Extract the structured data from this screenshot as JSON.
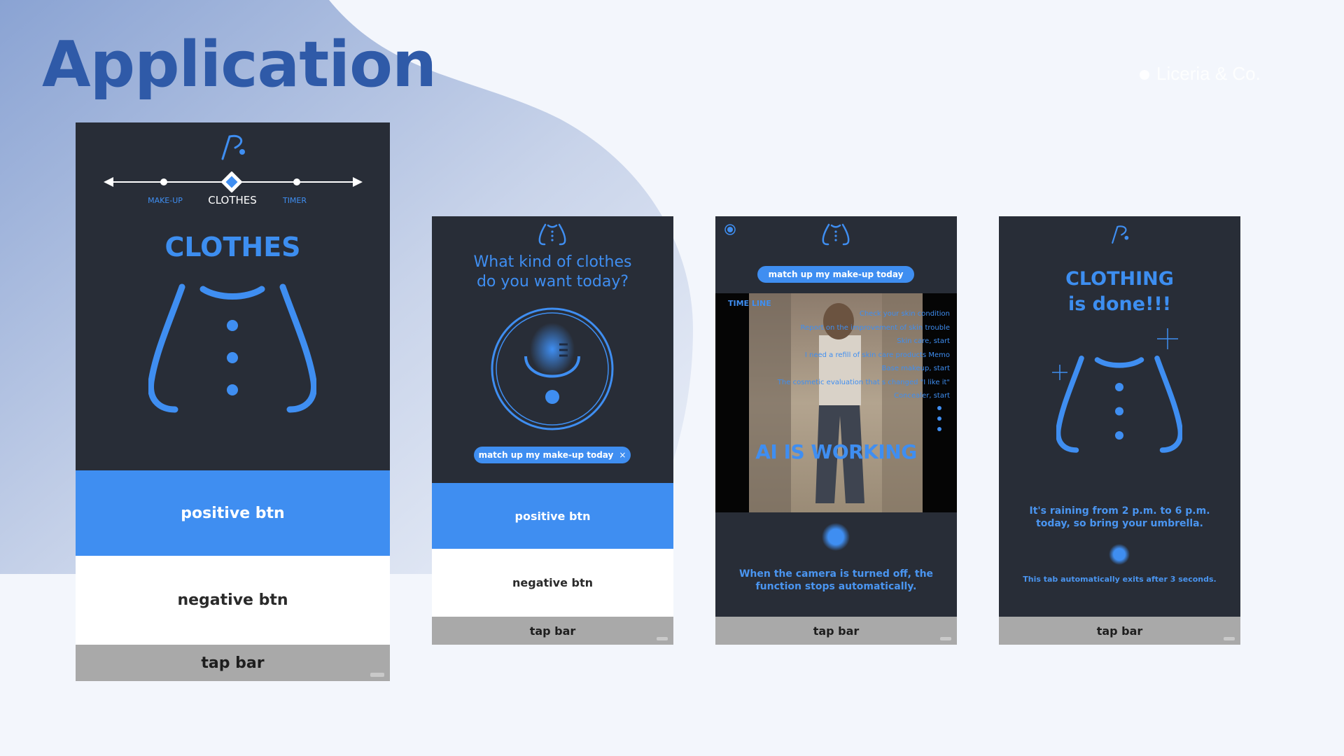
{
  "page": {
    "title": "Application",
    "brand": "Liceria & Co."
  },
  "screen1": {
    "nav": {
      "left_label": "MAKE-UP",
      "center_label": "CLOTHES",
      "right_label": "TIMER"
    },
    "heading": "CLOTHES",
    "positive_btn": "positive btn",
    "negative_btn": "negative btn",
    "tap_bar": "tap bar"
  },
  "screen2": {
    "question_line1": "What kind of clothes",
    "question_line2": "do you want today?",
    "chip": "match up my make-up today",
    "chip_close": "×",
    "positive_btn": "positive btn",
    "negative_btn": "negative btn",
    "tap_bar": "tap bar"
  },
  "screen3": {
    "pill": "match up my make-up today",
    "timeline_title": "TIME LINE",
    "timeline_items": [
      "Check your skin condition",
      "Report on the improvement of skin trouble",
      "Skin care, start",
      "I need a refill of skin care products Memo",
      "Base makeup, start",
      "The cosmetic evaluation that s changed \"I like it\"",
      "Concealer, start"
    ],
    "overlay": "AI IS WORKING",
    "info_line1": "When the camera is turned off, the",
    "info_line2": "function stops automatically.",
    "tap_bar": "tap bar"
  },
  "screen4": {
    "heading_line1": "CLOTHING",
    "heading_line2": "is done!!!",
    "info_line1": "It's raining from 2 p.m. to 6 p.m.",
    "info_line2": "today, so bring your umbrella.",
    "footnote": "This tab automatically exits after 3 seconds.",
    "tap_bar": "tap bar"
  },
  "colors": {
    "accent": "#3f8ef1",
    "panel": "#282d37",
    "title": "#2f5aa8",
    "tapbar": "#a9a9a9"
  }
}
